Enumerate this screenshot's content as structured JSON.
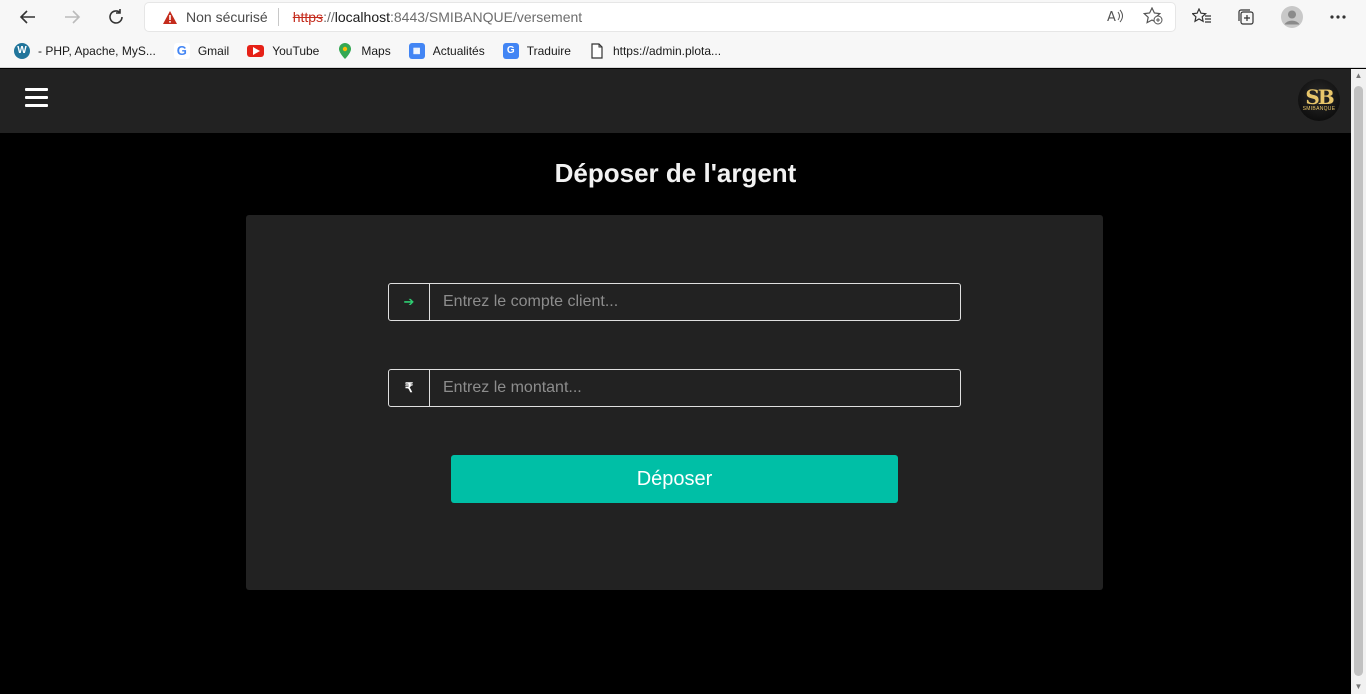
{
  "browser": {
    "security_label": "Non sécurisé",
    "url_scheme": "https",
    "url_sep": "://",
    "url_host": "localhost",
    "url_rest": ":8443/SMIBANQUE/versement",
    "bookmarks": [
      {
        "label": "- PHP, Apache, MyS...",
        "icon": "wordpress-icon"
      },
      {
        "label": "Gmail",
        "icon": "google-icon"
      },
      {
        "label": "YouTube",
        "icon": "youtube-icon"
      },
      {
        "label": "Maps",
        "icon": "maps-icon"
      },
      {
        "label": "Actualités",
        "icon": "news-icon"
      },
      {
        "label": "Traduire",
        "icon": "translate-icon"
      },
      {
        "label": "https://admin.plota...",
        "icon": "page-icon"
      }
    ]
  },
  "page": {
    "title": "Déposer de l'argent",
    "logo_text": "SB",
    "logo_sub": "SMIBANQUE",
    "account_field": {
      "placeholder": "Entrez le compte client...",
      "prefix": "➔"
    },
    "amount_field": {
      "placeholder": "Entrez le montant...",
      "prefix": "₹"
    },
    "submit_label": "Déposer"
  },
  "colors": {
    "accent": "#00bfa6",
    "background": "#000000",
    "card": "#222222",
    "prefix_arrow": "#2ecc71"
  }
}
